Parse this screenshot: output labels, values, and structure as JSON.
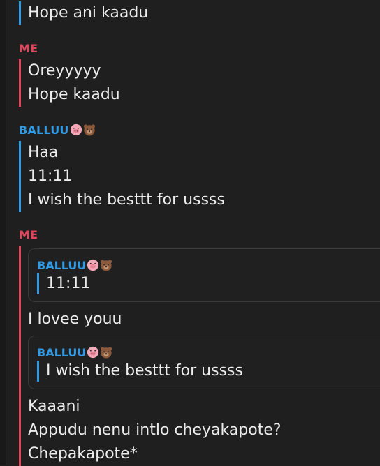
{
  "messages": [
    {
      "lines": [
        "Hope ani kaadu"
      ]
    },
    {
      "sender": "ME",
      "lines": [
        "Oreyyyyy",
        "Hope kaadu"
      ]
    },
    {
      "sender": "BALLUU",
      "lines": [
        "Haa",
        "11:11",
        "I wish the besttt for ussss"
      ]
    },
    {
      "sender": "ME",
      "quote1": {
        "sender": "BALLUU",
        "text": "11:11"
      },
      "reply1": "I lovee youu",
      "quote2": {
        "sender": "BALLUU",
        "text": "I wish the besttt for ussss"
      },
      "lines": [
        "Kaaani",
        "Appudu nenu intlo cheyakapote?",
        "Chepakapote*"
      ]
    }
  ],
  "icons": {
    "pig": "pig-face-emoji",
    "bear": "bear-face-emoji"
  },
  "colors": {
    "me": "#e2445c",
    "balluu": "#2f9be6",
    "background": "#1f1f1f"
  }
}
